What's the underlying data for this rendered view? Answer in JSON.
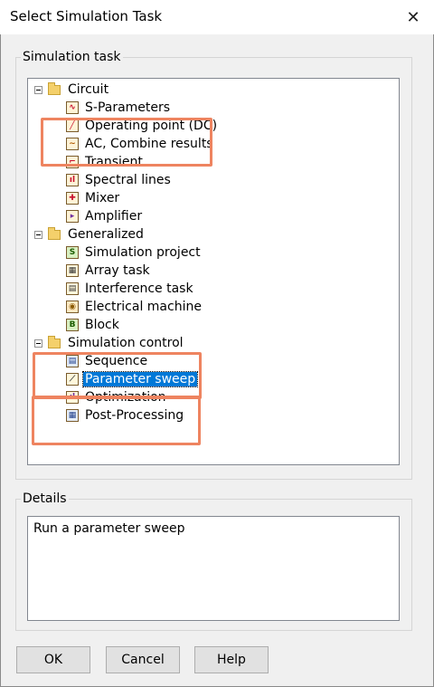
{
  "window": {
    "title": "Select Simulation Task",
    "close_glyph": "✕"
  },
  "simulation_task": {
    "legend": "Simulation task",
    "tree": [
      {
        "label": "Circuit",
        "type": "folder",
        "level": 0
      },
      {
        "label": "S-Parameters",
        "type": "item",
        "icon": "s-parameters-icon",
        "level": 1
      },
      {
        "label": "Operating point (DC)",
        "type": "item",
        "icon": "operating-point-icon",
        "level": 1
      },
      {
        "label": "AC, Combine results",
        "type": "item",
        "icon": "ac-icon",
        "level": 1
      },
      {
        "label": "Transient",
        "type": "item",
        "icon": "transient-icon",
        "level": 1
      },
      {
        "label": "Spectral lines",
        "type": "item",
        "icon": "spectral-lines-icon",
        "level": 1
      },
      {
        "label": "Mixer",
        "type": "item",
        "icon": "mixer-icon",
        "level": 1
      },
      {
        "label": "Amplifier",
        "type": "item",
        "icon": "amplifier-icon",
        "level": 1
      },
      {
        "label": "Generalized",
        "type": "folder",
        "level": 0
      },
      {
        "label": "Simulation project",
        "type": "item",
        "icon": "simulation-project-icon",
        "glyph": "S",
        "level": 1
      },
      {
        "label": "Array task",
        "type": "item",
        "icon": "array-task-icon",
        "level": 1
      },
      {
        "label": "Interference task",
        "type": "item",
        "icon": "interference-task-icon",
        "level": 1
      },
      {
        "label": "Electrical machine",
        "type": "item",
        "icon": "electrical-machine-icon",
        "level": 1
      },
      {
        "label": "Block",
        "type": "item",
        "icon": "block-icon",
        "glyph": "B",
        "level": 1
      },
      {
        "label": "Simulation control",
        "type": "folder",
        "level": 0
      },
      {
        "label": "Sequence",
        "type": "item",
        "icon": "sequence-icon",
        "level": 1
      },
      {
        "label": "Parameter sweep",
        "type": "item",
        "icon": "parameter-sweep-icon",
        "level": 1,
        "selected": true
      },
      {
        "label": "Optimization",
        "type": "item",
        "icon": "optimization-icon",
        "level": 1
      },
      {
        "label": "Post-Processing",
        "type": "item",
        "icon": "post-processing-icon",
        "level": 1
      }
    ]
  },
  "details": {
    "legend": "Details",
    "text": "Run a parameter sweep"
  },
  "buttons": {
    "ok": "OK",
    "cancel": "Cancel",
    "help": "Help"
  },
  "colors": {
    "highlight": "#ee8460",
    "selection": "#0078d7"
  }
}
